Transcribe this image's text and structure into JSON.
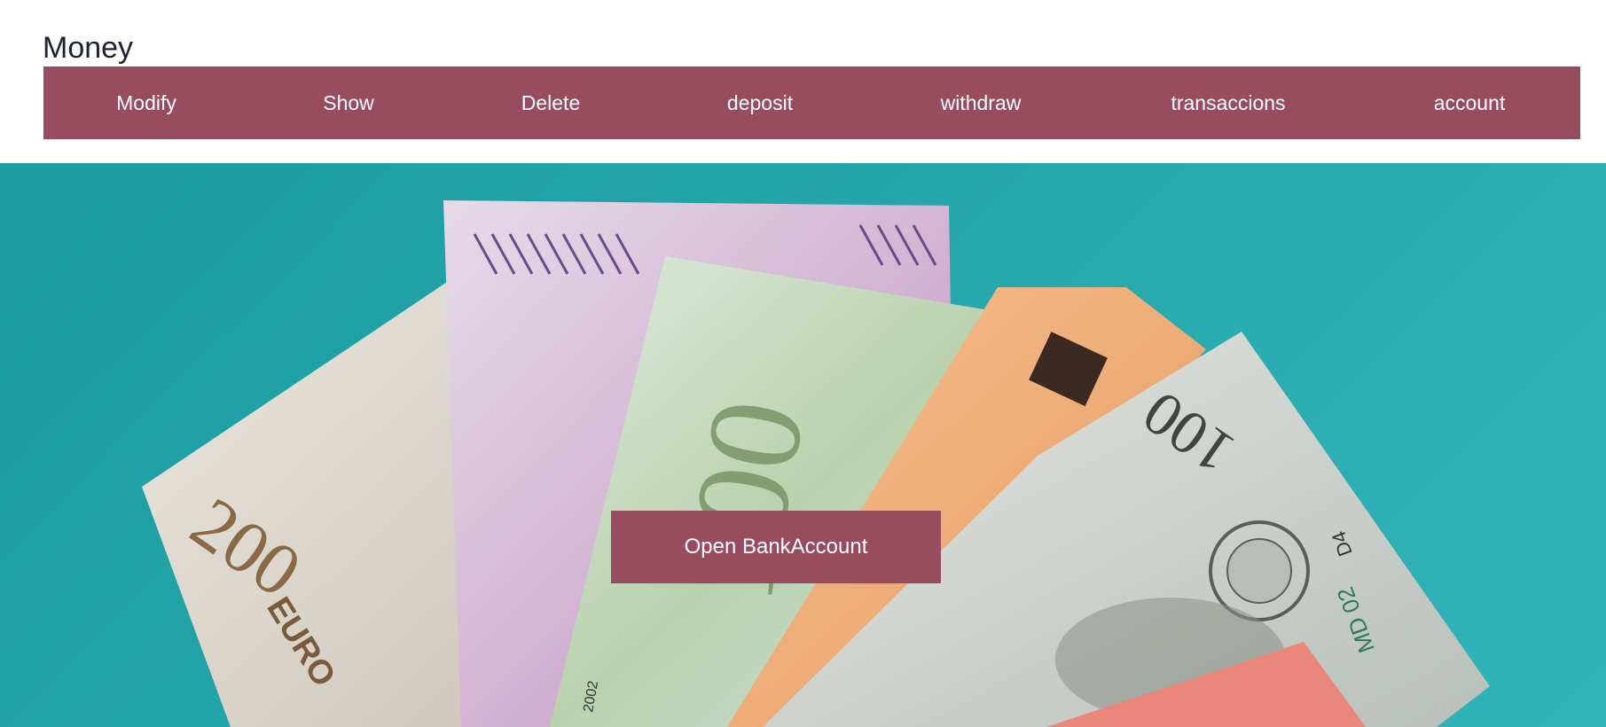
{
  "header": {
    "title": "Money"
  },
  "nav": {
    "items": [
      {
        "label": "Modify"
      },
      {
        "label": "Show"
      },
      {
        "label": "Delete"
      },
      {
        "label": "deposit"
      },
      {
        "label": "withdraw"
      },
      {
        "label": "transaccions"
      },
      {
        "label": "account"
      }
    ]
  },
  "hero": {
    "image": "banknotes-photo",
    "cta_label": "Open BankAccount",
    "notes": {
      "euro200": {
        "value": "200",
        "currency": "EURO"
      },
      "euro500": {
        "value": "500"
      },
      "euro100": {
        "value": "100"
      },
      "usd100": {
        "value": "100",
        "serial": "MD 02",
        "series": "D4"
      },
      "year": "2002"
    }
  },
  "colors": {
    "accent": "#984c60",
    "hero_bg": "#25a6ab",
    "title": "#1b2330"
  }
}
